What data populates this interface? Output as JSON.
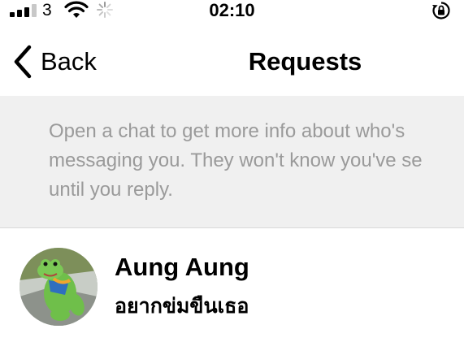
{
  "status_bar": {
    "signal_icon": "cellular-signal-icon",
    "carrier": "3",
    "wifi_icon": "wifi-icon",
    "activity_icon": "activity-spinner-icon",
    "time": "02:10",
    "rotation_lock_icon": "rotation-lock-icon"
  },
  "nav": {
    "back_icon": "chevron-left-icon",
    "back_label": "Back",
    "title": "Requests"
  },
  "info_banner": {
    "text": "Open a chat to get more info about who's\nmessaging you. They won't know you've se\nuntil you reply."
  },
  "requests": [
    {
      "name": "Aung Aung",
      "message": "อยากข่มขืนเธอ",
      "avatar_icon": "frog-avatar"
    }
  ],
  "colors": {
    "banner_background": "#f0f0f0",
    "banner_text": "#9a9a9a",
    "primary_text": "#000000"
  }
}
